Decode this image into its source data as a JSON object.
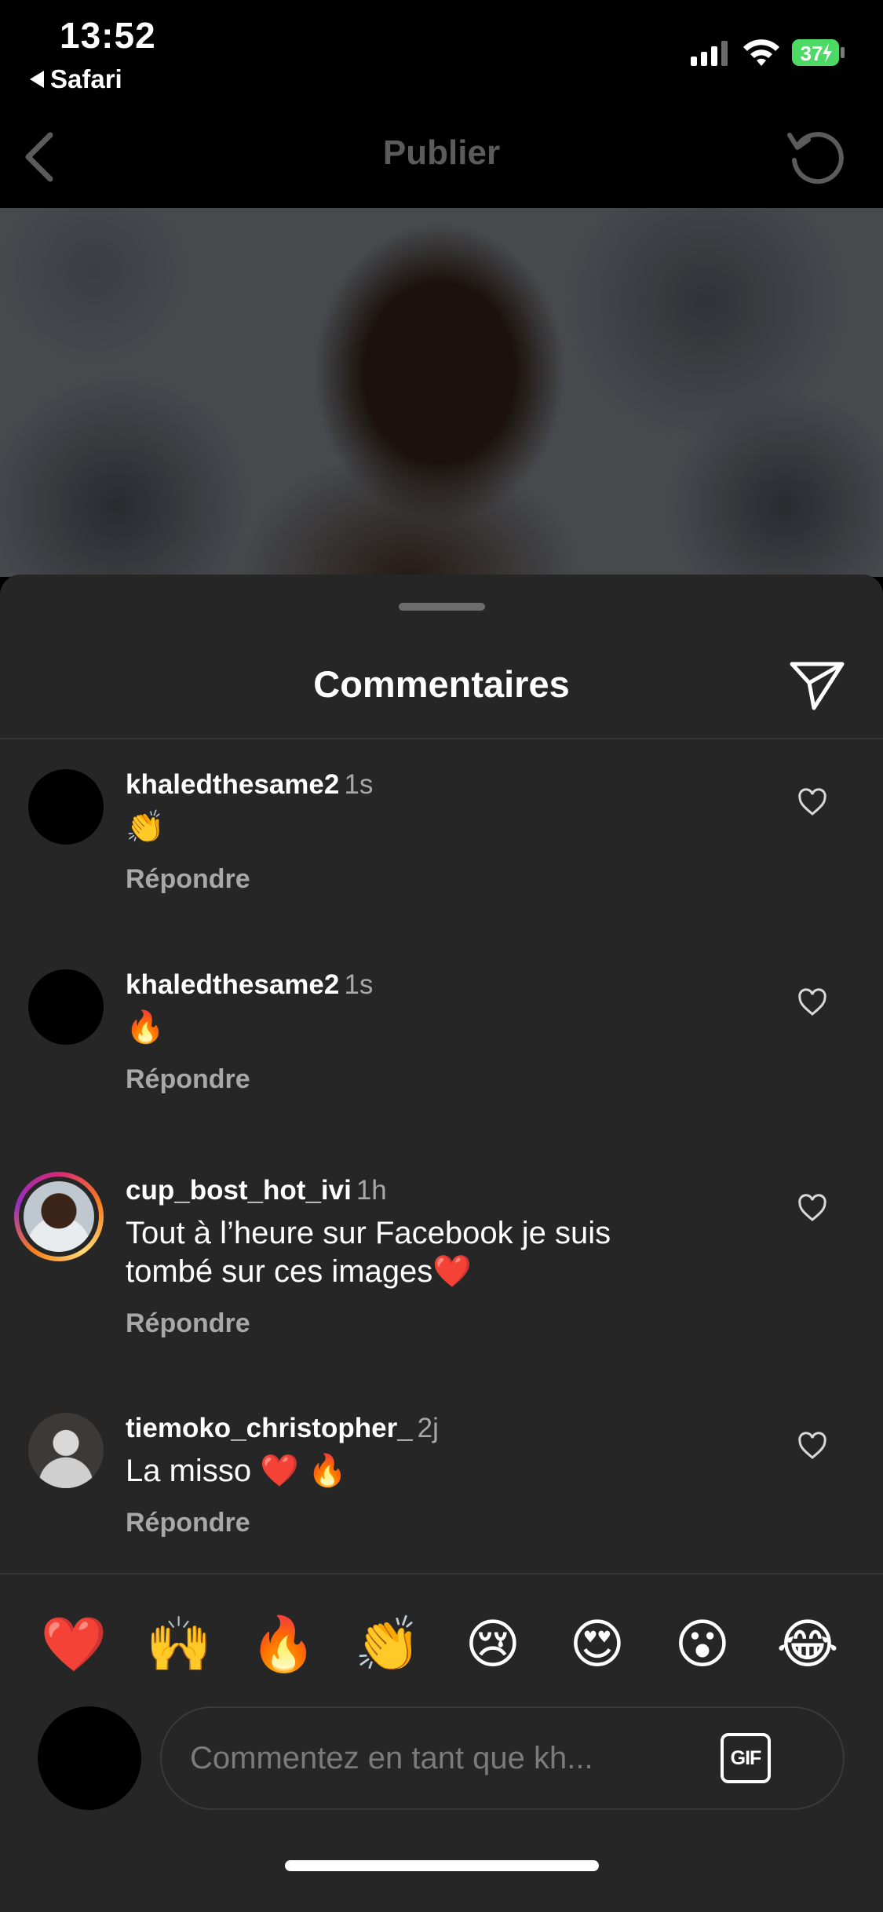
{
  "status": {
    "time": "13:52",
    "back_app": "Safari",
    "battery": "37"
  },
  "nav": {
    "title": "Publier"
  },
  "sheet": {
    "title": "Commentaires"
  },
  "comments": [
    {
      "username": "khaledthesame2",
      "time": "1s",
      "text": "👏",
      "reply": "Répondre"
    },
    {
      "username": "khaledthesame2",
      "time": "1s",
      "text": "🔥",
      "reply": "Répondre"
    },
    {
      "username": "cup_bost_hot_ivi",
      "time": "1h",
      "text": "Tout à l’heure sur Facebook je suis tombé sur ces images❤️",
      "reply": "Répondre"
    },
    {
      "username": "tiemoko_christopher_",
      "time": "2j",
      "text": "La misso ❤️ 🔥",
      "reply": "Répondre"
    }
  ],
  "quick_emojis": [
    "❤️",
    "🙌",
    "🔥",
    "👏",
    "😢",
    "😍",
    "😮",
    "😂"
  ],
  "composer": {
    "placeholder": "Commentez en tant que kh...",
    "gif_label": "GIF"
  },
  "colors": {
    "sheet_bg": "#262626",
    "secondary_text": "#a8a8a8",
    "battery_green": "#4cd964"
  }
}
